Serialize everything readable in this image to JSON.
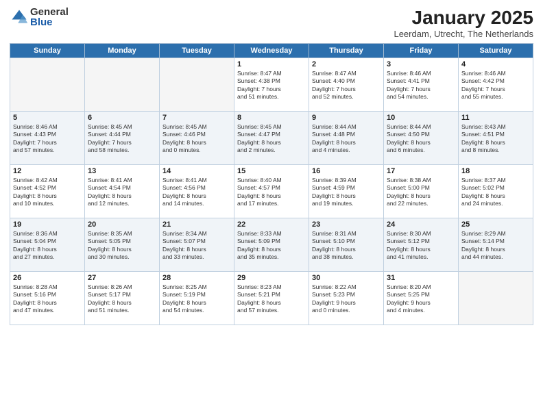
{
  "logo": {
    "general": "General",
    "blue": "Blue"
  },
  "title": {
    "month": "January 2025",
    "location": "Leerdam, Utrecht, The Netherlands"
  },
  "days_header": [
    "Sunday",
    "Monday",
    "Tuesday",
    "Wednesday",
    "Thursday",
    "Friday",
    "Saturday"
  ],
  "weeks": [
    [
      {
        "day": "",
        "info": ""
      },
      {
        "day": "",
        "info": ""
      },
      {
        "day": "",
        "info": ""
      },
      {
        "day": "1",
        "info": "Sunrise: 8:47 AM\nSunset: 4:38 PM\nDaylight: 7 hours\nand 51 minutes."
      },
      {
        "day": "2",
        "info": "Sunrise: 8:47 AM\nSunset: 4:40 PM\nDaylight: 7 hours\nand 52 minutes."
      },
      {
        "day": "3",
        "info": "Sunrise: 8:46 AM\nSunset: 4:41 PM\nDaylight: 7 hours\nand 54 minutes."
      },
      {
        "day": "4",
        "info": "Sunrise: 8:46 AM\nSunset: 4:42 PM\nDaylight: 7 hours\nand 55 minutes."
      }
    ],
    [
      {
        "day": "5",
        "info": "Sunrise: 8:46 AM\nSunset: 4:43 PM\nDaylight: 7 hours\nand 57 minutes."
      },
      {
        "day": "6",
        "info": "Sunrise: 8:45 AM\nSunset: 4:44 PM\nDaylight: 7 hours\nand 58 minutes."
      },
      {
        "day": "7",
        "info": "Sunrise: 8:45 AM\nSunset: 4:46 PM\nDaylight: 8 hours\nand 0 minutes."
      },
      {
        "day": "8",
        "info": "Sunrise: 8:45 AM\nSunset: 4:47 PM\nDaylight: 8 hours\nand 2 minutes."
      },
      {
        "day": "9",
        "info": "Sunrise: 8:44 AM\nSunset: 4:48 PM\nDaylight: 8 hours\nand 4 minutes."
      },
      {
        "day": "10",
        "info": "Sunrise: 8:44 AM\nSunset: 4:50 PM\nDaylight: 8 hours\nand 6 minutes."
      },
      {
        "day": "11",
        "info": "Sunrise: 8:43 AM\nSunset: 4:51 PM\nDaylight: 8 hours\nand 8 minutes."
      }
    ],
    [
      {
        "day": "12",
        "info": "Sunrise: 8:42 AM\nSunset: 4:52 PM\nDaylight: 8 hours\nand 10 minutes."
      },
      {
        "day": "13",
        "info": "Sunrise: 8:41 AM\nSunset: 4:54 PM\nDaylight: 8 hours\nand 12 minutes."
      },
      {
        "day": "14",
        "info": "Sunrise: 8:41 AM\nSunset: 4:56 PM\nDaylight: 8 hours\nand 14 minutes."
      },
      {
        "day": "15",
        "info": "Sunrise: 8:40 AM\nSunset: 4:57 PM\nDaylight: 8 hours\nand 17 minutes."
      },
      {
        "day": "16",
        "info": "Sunrise: 8:39 AM\nSunset: 4:59 PM\nDaylight: 8 hours\nand 19 minutes."
      },
      {
        "day": "17",
        "info": "Sunrise: 8:38 AM\nSunset: 5:00 PM\nDaylight: 8 hours\nand 22 minutes."
      },
      {
        "day": "18",
        "info": "Sunrise: 8:37 AM\nSunset: 5:02 PM\nDaylight: 8 hours\nand 24 minutes."
      }
    ],
    [
      {
        "day": "19",
        "info": "Sunrise: 8:36 AM\nSunset: 5:04 PM\nDaylight: 8 hours\nand 27 minutes."
      },
      {
        "day": "20",
        "info": "Sunrise: 8:35 AM\nSunset: 5:05 PM\nDaylight: 8 hours\nand 30 minutes."
      },
      {
        "day": "21",
        "info": "Sunrise: 8:34 AM\nSunset: 5:07 PM\nDaylight: 8 hours\nand 33 minutes."
      },
      {
        "day": "22",
        "info": "Sunrise: 8:33 AM\nSunset: 5:09 PM\nDaylight: 8 hours\nand 35 minutes."
      },
      {
        "day": "23",
        "info": "Sunrise: 8:31 AM\nSunset: 5:10 PM\nDaylight: 8 hours\nand 38 minutes."
      },
      {
        "day": "24",
        "info": "Sunrise: 8:30 AM\nSunset: 5:12 PM\nDaylight: 8 hours\nand 41 minutes."
      },
      {
        "day": "25",
        "info": "Sunrise: 8:29 AM\nSunset: 5:14 PM\nDaylight: 8 hours\nand 44 minutes."
      }
    ],
    [
      {
        "day": "26",
        "info": "Sunrise: 8:28 AM\nSunset: 5:16 PM\nDaylight: 8 hours\nand 47 minutes."
      },
      {
        "day": "27",
        "info": "Sunrise: 8:26 AM\nSunset: 5:17 PM\nDaylight: 8 hours\nand 51 minutes."
      },
      {
        "day": "28",
        "info": "Sunrise: 8:25 AM\nSunset: 5:19 PM\nDaylight: 8 hours\nand 54 minutes."
      },
      {
        "day": "29",
        "info": "Sunrise: 8:23 AM\nSunset: 5:21 PM\nDaylight: 8 hours\nand 57 minutes."
      },
      {
        "day": "30",
        "info": "Sunrise: 8:22 AM\nSunset: 5:23 PM\nDaylight: 9 hours\nand 0 minutes."
      },
      {
        "day": "31",
        "info": "Sunrise: 8:20 AM\nSunset: 5:25 PM\nDaylight: 9 hours\nand 4 minutes."
      },
      {
        "day": "",
        "info": ""
      }
    ]
  ]
}
